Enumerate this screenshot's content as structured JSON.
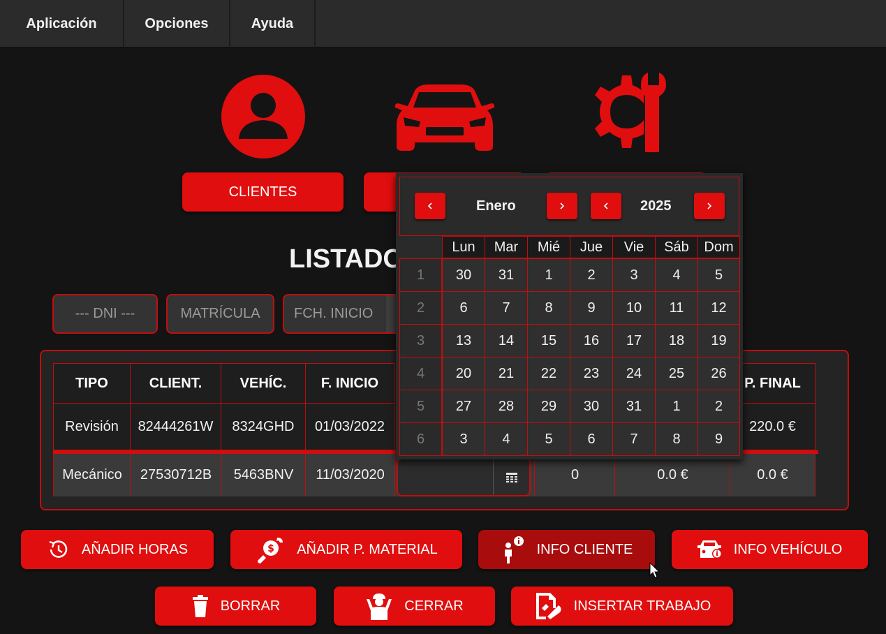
{
  "menu": {
    "items": [
      "Aplicación",
      "Opciones",
      "Ayuda"
    ]
  },
  "sections": {
    "clientes_label": "CLIENTES"
  },
  "title": "LISTADO",
  "filters": {
    "dni_placeholder": "--- DNI ---",
    "matricula_placeholder": "MATRÍCULA",
    "fch_inicio_placeholder": "FCH. INICIO"
  },
  "table": {
    "headers": [
      "TIPO",
      "CLIENT.",
      "VEHÍC.",
      "F. INICIO",
      "P. FINAL"
    ],
    "rows": [
      {
        "tipo": "Revisión",
        "cliente": "82444261W",
        "vehiculo": "8324GHD",
        "f_inicio": "01/03/2022",
        "p_final": "220.0 €"
      },
      {
        "tipo": "Mecánico",
        "cliente": "27530712B",
        "vehiculo": "5463BNV",
        "f_inicio": "11/03/2020",
        "horas": "0",
        "p_material": "0.0 €",
        "p_final": "0.0 €"
      }
    ]
  },
  "calendar": {
    "month": "Enero",
    "year": "2025",
    "day_names": [
      "Lun",
      "Mar",
      "Mié",
      "Jue",
      "Vie",
      "Sáb",
      "Dom"
    ],
    "weeks": [
      "1",
      "2",
      "3",
      "4",
      "5",
      "6"
    ],
    "days": [
      [
        "30",
        "31",
        "1",
        "2",
        "3",
        "4",
        "5"
      ],
      [
        "6",
        "7",
        "8",
        "9",
        "10",
        "11",
        "12"
      ],
      [
        "13",
        "14",
        "15",
        "16",
        "17",
        "18",
        "19"
      ],
      [
        "20",
        "21",
        "22",
        "23",
        "24",
        "25",
        "26"
      ],
      [
        "27",
        "28",
        "29",
        "30",
        "31",
        "1",
        "2"
      ],
      [
        "3",
        "4",
        "5",
        "6",
        "7",
        "8",
        "9"
      ]
    ]
  },
  "actions": {
    "add_hours": "AÑADIR HORAS",
    "add_material": "AÑADIR P. MATERIAL",
    "client_info": "INFO CLIENTE",
    "vehicle_info": "INFO VEHÍCULO",
    "delete": "BORRAR",
    "close": "CERRAR",
    "insert_job": "INSERTAR TRABAJO"
  },
  "colors": {
    "accent": "#e00e0e",
    "accent_dark": "#a80c0c",
    "background": "#141414"
  }
}
